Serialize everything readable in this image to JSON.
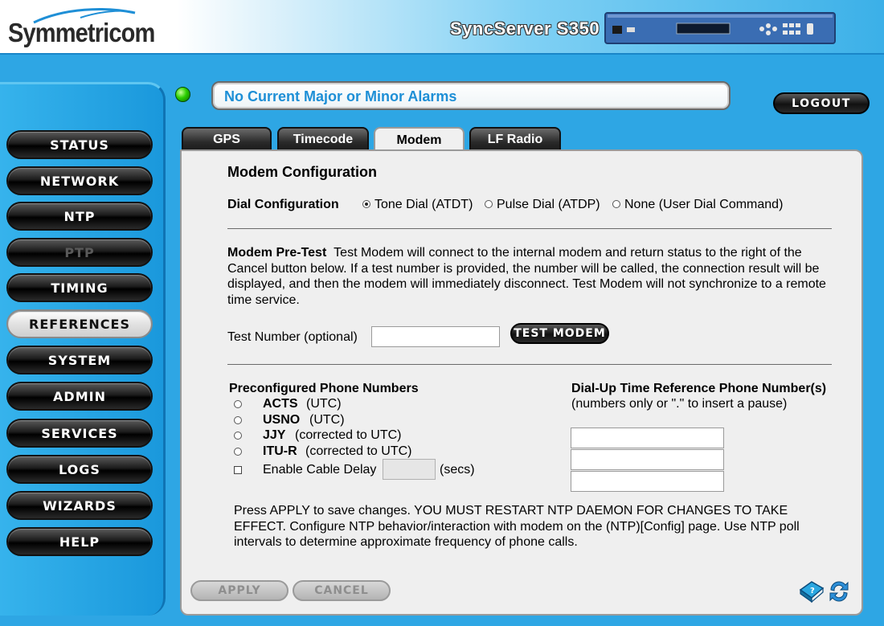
{
  "header": {
    "brand": "Symmetricom",
    "product": "SyncServer S350"
  },
  "colors": {
    "accent": "#2ea6e4",
    "alarm_text": "#1e8fd6",
    "led": "#2bcf00"
  },
  "alarm": {
    "message": "No Current Major or Minor Alarms",
    "led_icon": "green-status-led-icon"
  },
  "logout_label": "LOGOUT",
  "sidebar": {
    "items": [
      {
        "label": "STATUS",
        "state": "normal"
      },
      {
        "label": "NETWORK",
        "state": "normal"
      },
      {
        "label": "NTP",
        "state": "normal"
      },
      {
        "label": "PTP",
        "state": "disabled"
      },
      {
        "label": "TIMING",
        "state": "normal"
      },
      {
        "label": "REFERENCES",
        "state": "active"
      },
      {
        "label": "SYSTEM",
        "state": "normal"
      },
      {
        "label": "ADMIN",
        "state": "normal"
      },
      {
        "label": "SERVICES",
        "state": "normal"
      },
      {
        "label": "LOGS",
        "state": "normal"
      },
      {
        "label": "WIZARDS",
        "state": "normal"
      },
      {
        "label": "HELP",
        "state": "normal"
      }
    ]
  },
  "tabs": [
    {
      "label": "GPS",
      "active": false
    },
    {
      "label": "Timecode",
      "active": false
    },
    {
      "label": "Modem",
      "active": true
    },
    {
      "label": "LF Radio",
      "active": false
    }
  ],
  "modem": {
    "title": "Modem Configuration",
    "dial_config": {
      "label": "Dial Configuration",
      "options": [
        {
          "label": "Tone Dial (ATDT)",
          "selected": true
        },
        {
          "label": "Pulse Dial (ATDP)",
          "selected": false
        },
        {
          "label": "None (User Dial Command)",
          "selected": false
        }
      ]
    },
    "pretest": {
      "heading": "Modem Pre-Test",
      "text": "Test Modem will connect to the internal modem and return status to the right of the Cancel button below. If a test number is provided, the number will be called, the connection result will be displayed, and then the modem will immediately disconnect. Test Modem will not synchronize to a remote time service."
    },
    "test_number": {
      "label": "Test Number (optional)",
      "value": "",
      "button": "TEST MODEM"
    },
    "preconfigured": {
      "heading": "Preconfigured Phone Numbers",
      "items": [
        {
          "name": "ACTS",
          "note": "(UTC)",
          "selected": false
        },
        {
          "name": "USNO",
          "note": "(UTC)",
          "selected": false
        },
        {
          "name": "JJY",
          "note": "(corrected to UTC)",
          "selected": false
        },
        {
          "name": "ITU-R",
          "note": "(corrected to UTC)",
          "selected": false
        }
      ],
      "cable_delay": {
        "label": "Enable Cable Delay",
        "value": "",
        "unit": "(secs)",
        "checked": false
      }
    },
    "dialup": {
      "heading": "Dial-Up Time Reference Phone Number(s)",
      "subtext": "(numbers only or \".\" to insert a pause)",
      "values": [
        "",
        "",
        ""
      ]
    },
    "notice": "Press APPLY to save changes. YOU MUST RESTART NTP DAEMON FOR CHANGES TO TAKE EFFECT. Configure NTP behavior/interaction with modem on the (NTP)[Config] page. Use NTP poll intervals to determine approximate frequency of phone calls."
  },
  "footer": {
    "apply_label": "APPLY",
    "cancel_label": "CANCEL",
    "help_icon": "help-book-icon",
    "refresh_icon": "refresh-icon"
  }
}
